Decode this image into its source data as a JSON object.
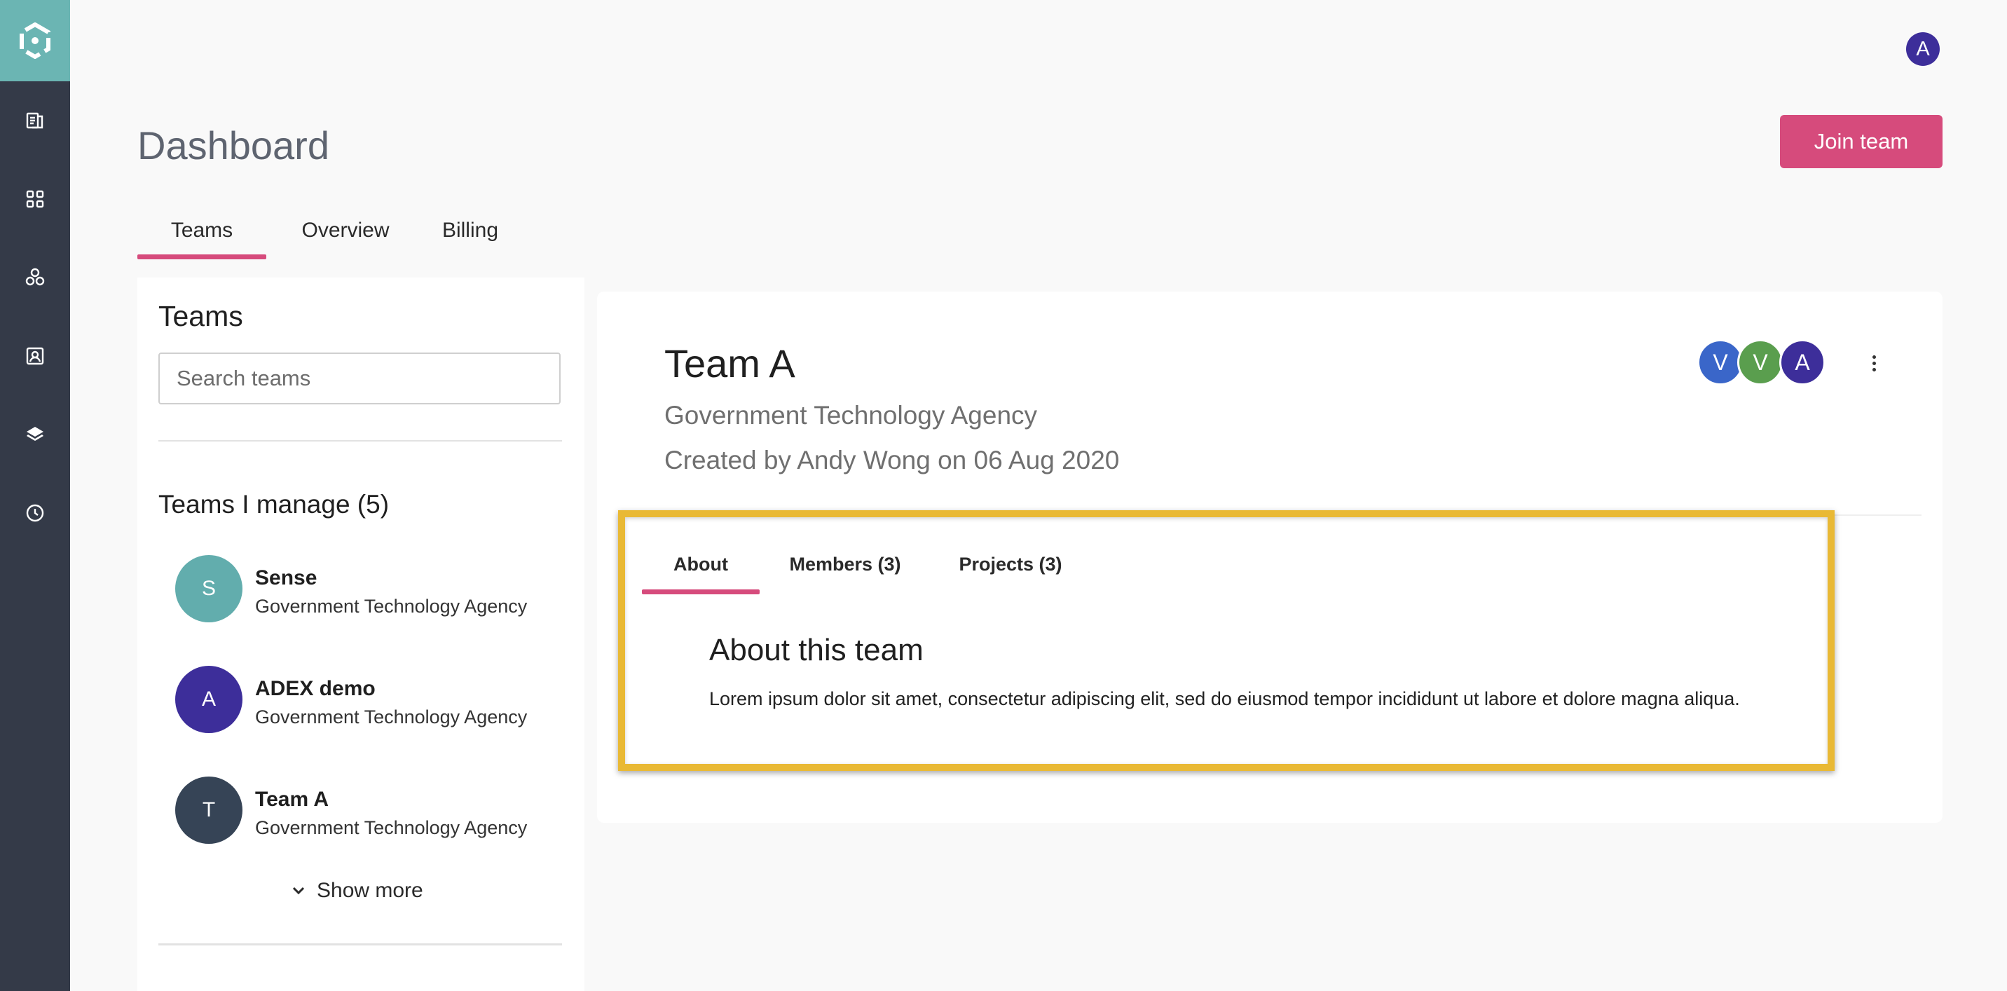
{
  "header": {
    "user_avatar_initial": "A"
  },
  "page": {
    "title": "Dashboard",
    "join_button_label": "Join team"
  },
  "main_tabs": [
    {
      "label": "Teams",
      "active": true
    },
    {
      "label": "Overview",
      "active": false
    },
    {
      "label": "Billing",
      "active": false
    }
  ],
  "teams_panel": {
    "title": "Teams",
    "search_placeholder": "Search teams",
    "manage_title": "Teams I manage (5)",
    "teams": [
      {
        "initial": "S",
        "name": "Sense",
        "org": "Government Technology Agency",
        "color": "#62adad"
      },
      {
        "initial": "A",
        "name": "ADEX demo",
        "org": "Government Technology Agency",
        "color": "#3d2e9a"
      },
      {
        "initial": "T",
        "name": "Team A",
        "org": "Government Technology Agency",
        "color": "#364456"
      }
    ],
    "show_more_label": "Show more"
  },
  "team_detail": {
    "name": "Team A",
    "org": "Government Technology Agency",
    "created": "Created by Andy Wong on 06 Aug 2020",
    "members": [
      {
        "initial": "V",
        "color": "#3a66c9"
      },
      {
        "initial": "V",
        "color": "#5a9e4e"
      },
      {
        "initial": "A",
        "color": "#3d2e9a"
      }
    ],
    "tabs": [
      {
        "label": "About",
        "active": true
      },
      {
        "label": "Members (3)",
        "active": false
      },
      {
        "label": "Projects (3)",
        "active": false
      }
    ],
    "about_title": "About this team",
    "about_text": "Lorem ipsum dolor sit amet, consectetur adipiscing elit, sed do eiusmod tempor incididunt ut labore et dolore magna aliqua."
  },
  "sidebar": {
    "items": [
      {
        "icon": "documents-icon"
      },
      {
        "icon": "grid-icon"
      },
      {
        "icon": "network-icon"
      },
      {
        "icon": "contact-card-icon"
      },
      {
        "icon": "layers-icon"
      },
      {
        "icon": "clock-icon"
      }
    ]
  },
  "colors": {
    "accent": "#d64b7c",
    "sidebar": "#343a48",
    "logo_bg": "#6bb5b3",
    "highlight": "#e9b935"
  }
}
